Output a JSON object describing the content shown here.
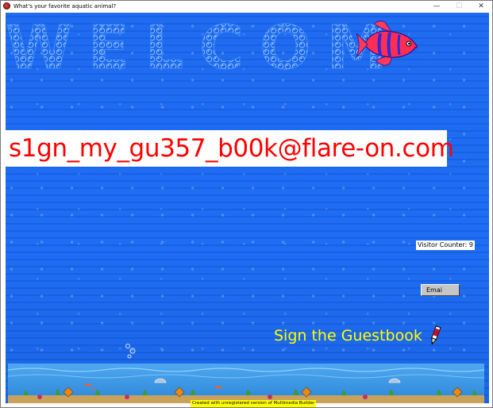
{
  "window": {
    "title": "What's your favorite aquatic animal?",
    "minimize_glyph": "—",
    "maximize_glyph": "☐",
    "close_glyph": "✕"
  },
  "banner": {
    "welcome_text": "WELCOM"
  },
  "email": {
    "address": "s1gn_my_gu357_b00k@flare-on.com"
  },
  "visitor_counter": {
    "text": "Visitor Counter: 9"
  },
  "buttons": {
    "email_label": "Emai"
  },
  "guestbook": {
    "label": "Sign the Guestbook"
  },
  "footer": {
    "note": "Created with unregistered version of Multimedia Builder"
  },
  "colors": {
    "water": "#1e6df2",
    "email_text": "#ff0000",
    "guestbook_text": "#ffff00",
    "footer_bg": "#ffff00"
  },
  "icons": {
    "app": "app-icon",
    "fish": "fish-icon",
    "pencil": "pencil-icon"
  }
}
